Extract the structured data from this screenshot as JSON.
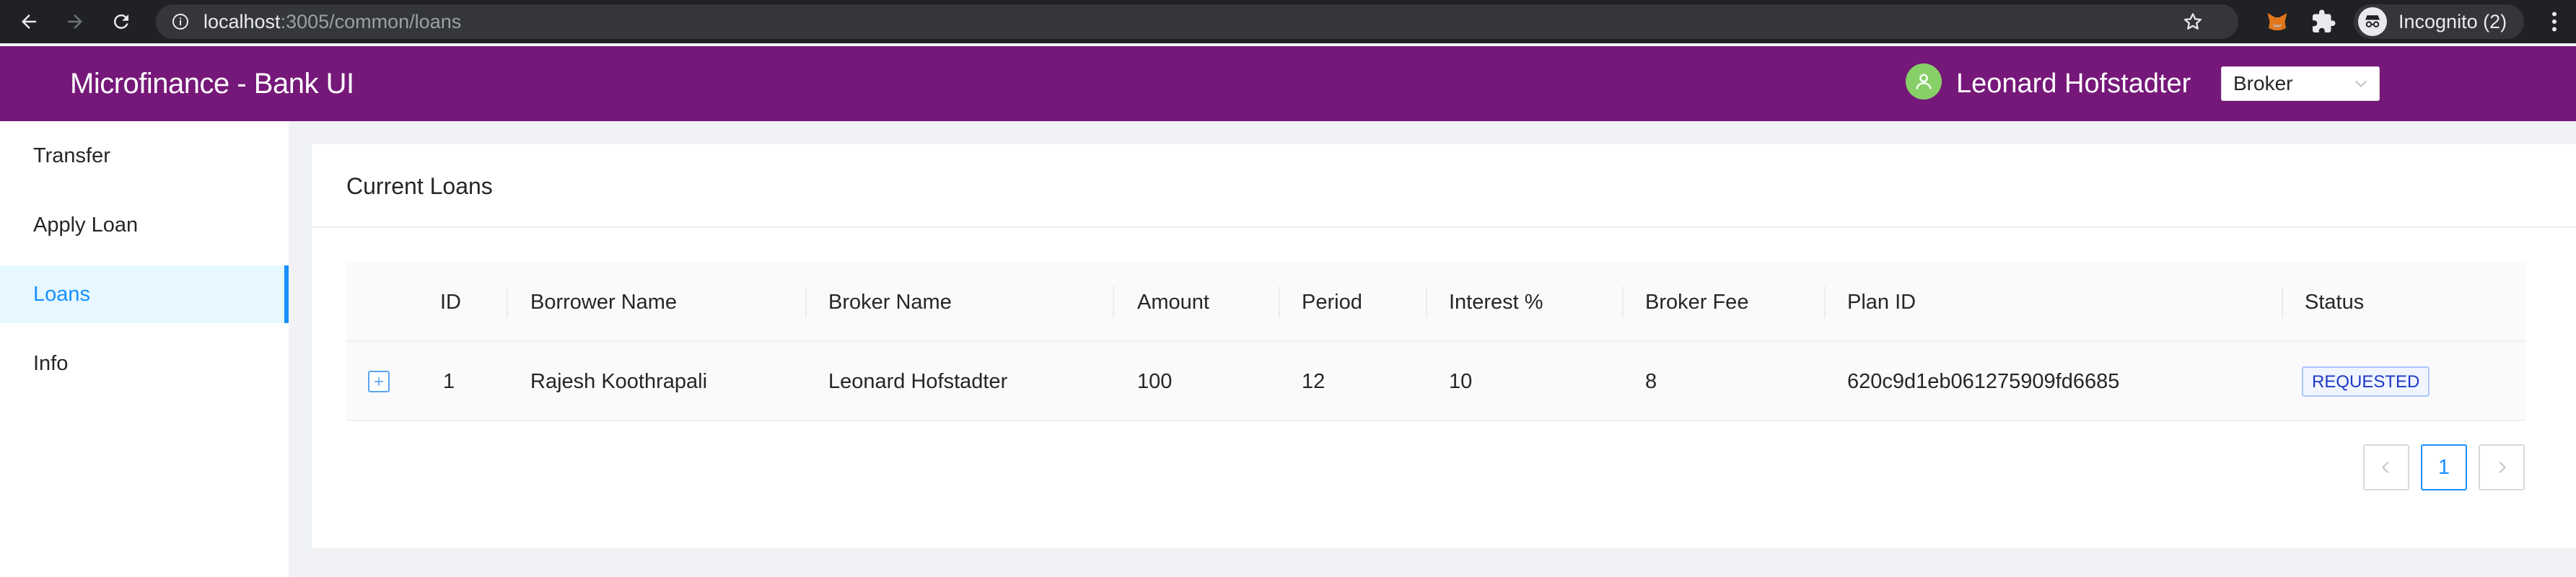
{
  "browser": {
    "url_host": "localhost",
    "url_path": ":3005/common/loans",
    "incognito_label": "Incognito (2)"
  },
  "header": {
    "title": "Microfinance - Bank UI",
    "user_name": "Leonard Hofstadter",
    "role": "Broker",
    "color": "#76187a"
  },
  "sidebar": {
    "items": [
      {
        "label": "Transfer"
      },
      {
        "label": "Apply Loan"
      },
      {
        "label": "Loans"
      },
      {
        "label": "Info"
      }
    ],
    "active": "Loans"
  },
  "main": {
    "title": "Current Loans",
    "table": {
      "columns": [
        "ID",
        "Borrower Name",
        "Broker Name",
        "Amount",
        "Period",
        "Interest %",
        "Broker Fee",
        "Plan ID",
        "Status"
      ],
      "rows": [
        {
          "id": "1",
          "borrower": "Rajesh Koothrapali",
          "broker": "Leonard Hofstadter",
          "amount": "100",
          "period": "12",
          "interest": "10",
          "broker_fee": "8",
          "plan_id": "620c9d1eb061275909fd6685",
          "status": "REQUESTED"
        }
      ]
    },
    "pagination": {
      "current_page": "1"
    }
  },
  "icons": {
    "back": "arrow-left-icon",
    "forward": "arrow-right-icon",
    "reload": "reload-icon",
    "info": "info-icon",
    "bookmark": "star-icon",
    "extension": "puzzle-icon",
    "user": "user-icon",
    "expand": "plus-icon"
  }
}
